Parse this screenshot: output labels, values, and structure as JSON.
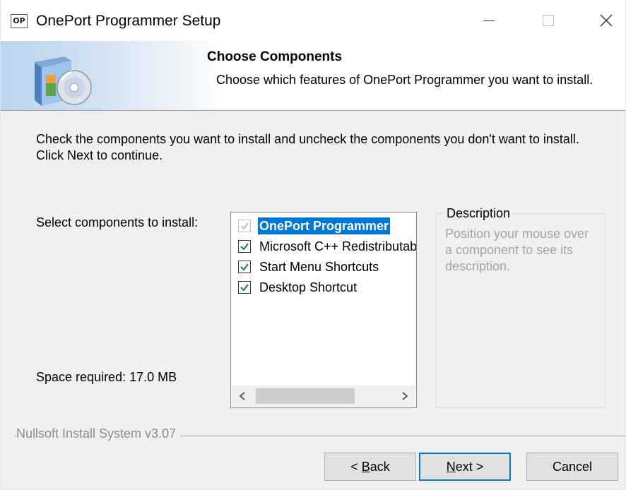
{
  "window": {
    "title": "OnePort Programmer Setup",
    "icon_text": "OP"
  },
  "header": {
    "title": "Choose Components",
    "subtitle": "Choose which features of OnePort Programmer you want to install."
  },
  "body": {
    "instructions": "Check the components you want to install and uncheck the components you don't want to install. Click Next to continue.",
    "select_label": "Select components to install:",
    "space_required": "Space required: 17.0 MB"
  },
  "components": [
    {
      "label": "OnePort Programmer",
      "checked": true,
      "disabled": true,
      "selected": true
    },
    {
      "label": "Microsoft C++ Redistributable",
      "checked": true,
      "disabled": false,
      "selected": false
    },
    {
      "label": "Start Menu Shortcuts",
      "checked": true,
      "disabled": false,
      "selected": false
    },
    {
      "label": "Desktop Shortcut",
      "checked": true,
      "disabled": false,
      "selected": false
    }
  ],
  "description": {
    "legend": "Description",
    "text": "Position your mouse over a component to see its description."
  },
  "footer": {
    "brand": "Nullsoft Install System v3.07",
    "back": {
      "mnemonic": "B",
      "pre": "< ",
      "post": "ack"
    },
    "next": {
      "mnemonic": "N",
      "pre": "",
      "post": "ext >"
    },
    "cancel": "Cancel"
  },
  "colors": {
    "selection": "#0078d7",
    "check": "#1e7b34",
    "disabled_check": "#c0c0c0",
    "default_button_border": "#0078d7"
  },
  "icons": {
    "app": "installer-op-icon",
    "banner": "software-box-cd-icon",
    "minimize": "minimize-icon",
    "maximize": "maximize-icon",
    "close": "close-icon",
    "scroll_left": "chevron-left-icon",
    "scroll_right": "chevron-right-icon"
  }
}
